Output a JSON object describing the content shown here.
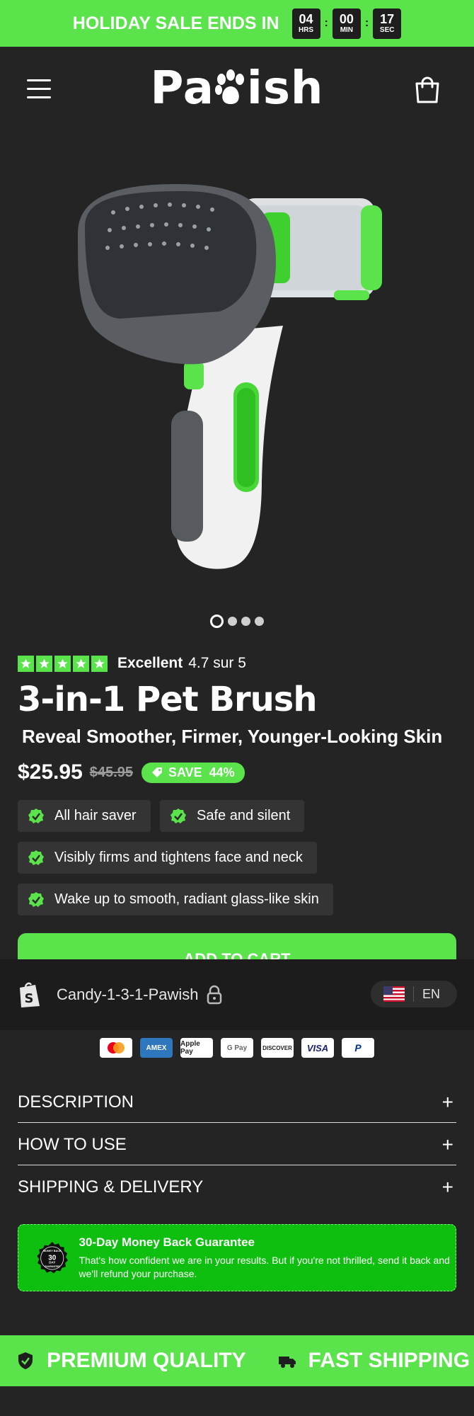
{
  "promo": {
    "text": "HOLIDAY SALE ENDS IN",
    "timer": [
      {
        "value": "04",
        "unit": "HRS"
      },
      {
        "value": "00",
        "unit": "MIN"
      },
      {
        "value": "17",
        "unit": "SEC"
      }
    ],
    "separator": ":"
  },
  "header": {
    "logo_left": "Pa",
    "logo_right": "ish"
  },
  "gallery": {
    "slide_count": 4,
    "active_index": 0
  },
  "rating": {
    "stars": 5,
    "label": "Excellent",
    "score": "4.7 sur 5"
  },
  "product": {
    "title": "3-in-1 Pet Brush",
    "subtitle": "Reveal Smoother, Firmer, Younger-Looking Skin",
    "price": "$25.95",
    "compare_price": "$45.95",
    "save_label": "SAVE  44%"
  },
  "features": [
    "All hair saver",
    "Safe and silent",
    "Visibly firms and tightens face and neck",
    "Wake up to smooth, radiant glass-like skin"
  ],
  "add_to_cart": "ADD TO CART",
  "shop_bar": {
    "shop_name": "Candy-1-3-1-Pawish",
    "language": "EN"
  },
  "payments": [
    "mastercard",
    "AMEX",
    "Apple Pay",
    "G Pay",
    "DISCOVER",
    "VISA",
    "P"
  ],
  "accordion": [
    {
      "title": "DESCRIPTION",
      "icon": "+"
    },
    {
      "title": "HOW TO USE",
      "icon": "+"
    },
    {
      "title": "SHIPPING & DELIVERY",
      "icon": "+"
    }
  ],
  "guarantee": {
    "badge_top": "MONEY BACK",
    "badge_num": "30",
    "badge_day": "DAY",
    "badge_bottom": "GUARANTEE",
    "title": "30-Day Money Back Guarantee",
    "body": "That's how confident we are in your results. But if you're not thrilled, send it back and we'll refund your purchase."
  },
  "footer_strip": [
    {
      "label": "PREMIUM QUALITY",
      "icon": "shield-check-icon"
    },
    {
      "label": "FAST SHIPPING",
      "icon": "truck-icon"
    }
  ],
  "colors": {
    "accent": "#5be34c",
    "background": "#242424",
    "guarantee": "#0fbf0f"
  }
}
